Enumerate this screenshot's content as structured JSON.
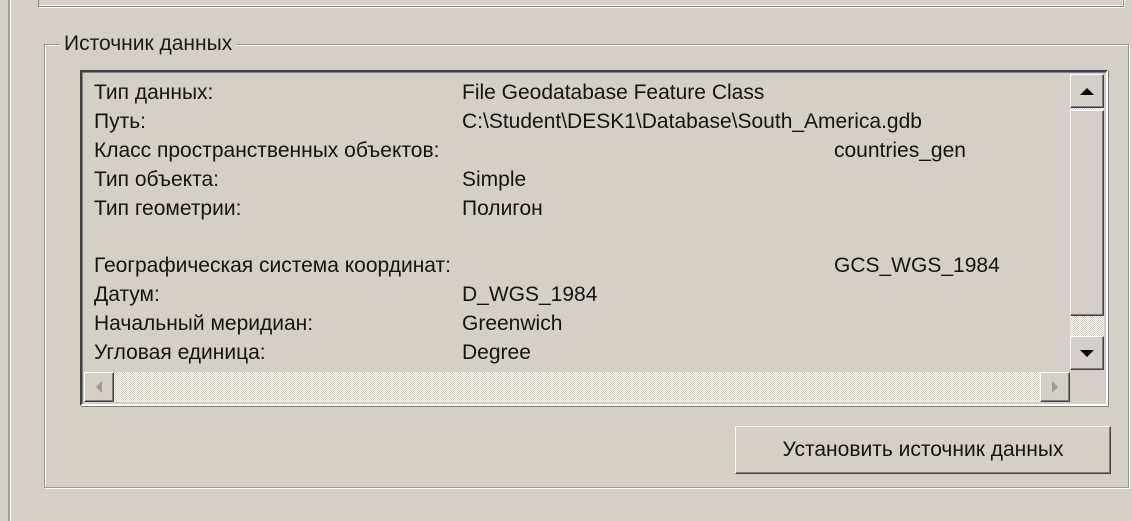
{
  "groupbox": {
    "title": "Источник данных"
  },
  "properties": [
    {
      "label": "Тип данных:",
      "value": "File Geodatabase Feature Class",
      "col": "near"
    },
    {
      "label": "Путь:",
      "value": "C:\\Student\\DESK1\\Database\\South_America.gdb",
      "col": "near"
    },
    {
      "label": "Класс пространственных объектов:",
      "value": "countries_gen",
      "col": "far"
    },
    {
      "label": "Тип объекта:",
      "value": "Simple",
      "col": "near"
    },
    {
      "label": "Тип геометрии:",
      "value": "Полигон",
      "col": "near"
    },
    {
      "label": "Географическая система координат:",
      "value": "GCS_WGS_1984",
      "col": "far"
    },
    {
      "label": "Датум:",
      "value": "D_WGS_1984",
      "col": "near"
    },
    {
      "label": "Начальный меридиан:",
      "value": "Greenwich",
      "col": "near"
    },
    {
      "label": "Угловая единица:",
      "value": "Degree",
      "col": "near"
    }
  ],
  "buttons": {
    "set_source": "Установить источник данных"
  },
  "icons": {
    "scroll_up": "scroll-up-arrow-icon",
    "scroll_down": "scroll-down-arrow-icon",
    "scroll_left": "scroll-left-arrow-icon",
    "scroll_right": "scroll-right-arrow-icon"
  },
  "colors": {
    "face": "#d4d0c8",
    "text": "#141414",
    "shadow": "#808080",
    "highlight": "#ffffff"
  }
}
